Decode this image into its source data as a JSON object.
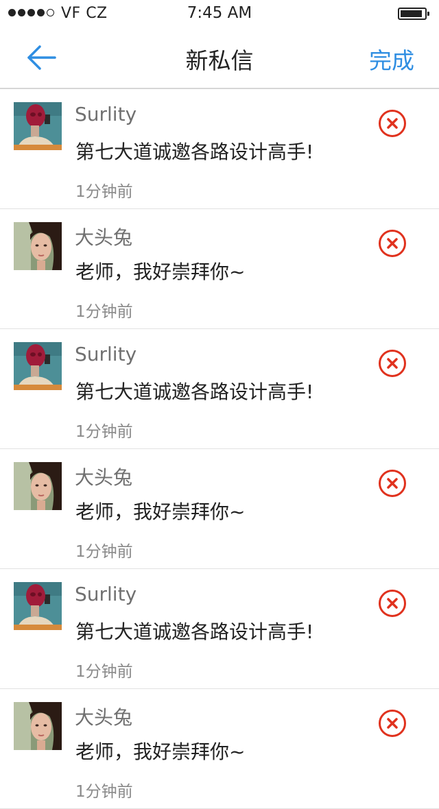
{
  "status_bar": {
    "carrier": "VF CZ",
    "time": "7:45 AM",
    "signal_filled_dots": 4,
    "signal_total_dots": 5,
    "battery_level": 0.9
  },
  "nav": {
    "back_icon": "back-arrow-icon",
    "title": "新私信",
    "done_label": "完成"
  },
  "colors": {
    "accent": "#2f8ee2",
    "delete": "#e0321e",
    "name_text": "#707070",
    "time_text": "#8a8a8a"
  },
  "messages": [
    {
      "avatar": "red-face-portrait",
      "name": "Surlity",
      "text": "第七大道诚邀各路设计高手!",
      "time": "1分钟前",
      "action_icon": "delete-circle-icon"
    },
    {
      "avatar": "girl-portrait",
      "name": "大头兔",
      "text": "老师，我好崇拜你~",
      "time": "1分钟前",
      "action_icon": "delete-circle-icon"
    },
    {
      "avatar": "red-face-portrait",
      "name": "Surlity",
      "text": "第七大道诚邀各路设计高手!",
      "time": "1分钟前",
      "action_icon": "delete-circle-icon"
    },
    {
      "avatar": "girl-portrait",
      "name": "大头兔",
      "text": "老师，我好崇拜你~",
      "time": "1分钟前",
      "action_icon": "delete-circle-icon"
    },
    {
      "avatar": "red-face-portrait",
      "name": "Surlity",
      "text": "第七大道诚邀各路设计高手!",
      "time": "1分钟前",
      "action_icon": "delete-circle-icon"
    },
    {
      "avatar": "girl-portrait",
      "name": "大头兔",
      "text": "老师，我好崇拜你~",
      "time": "1分钟前",
      "action_icon": "delete-circle-icon"
    }
  ]
}
